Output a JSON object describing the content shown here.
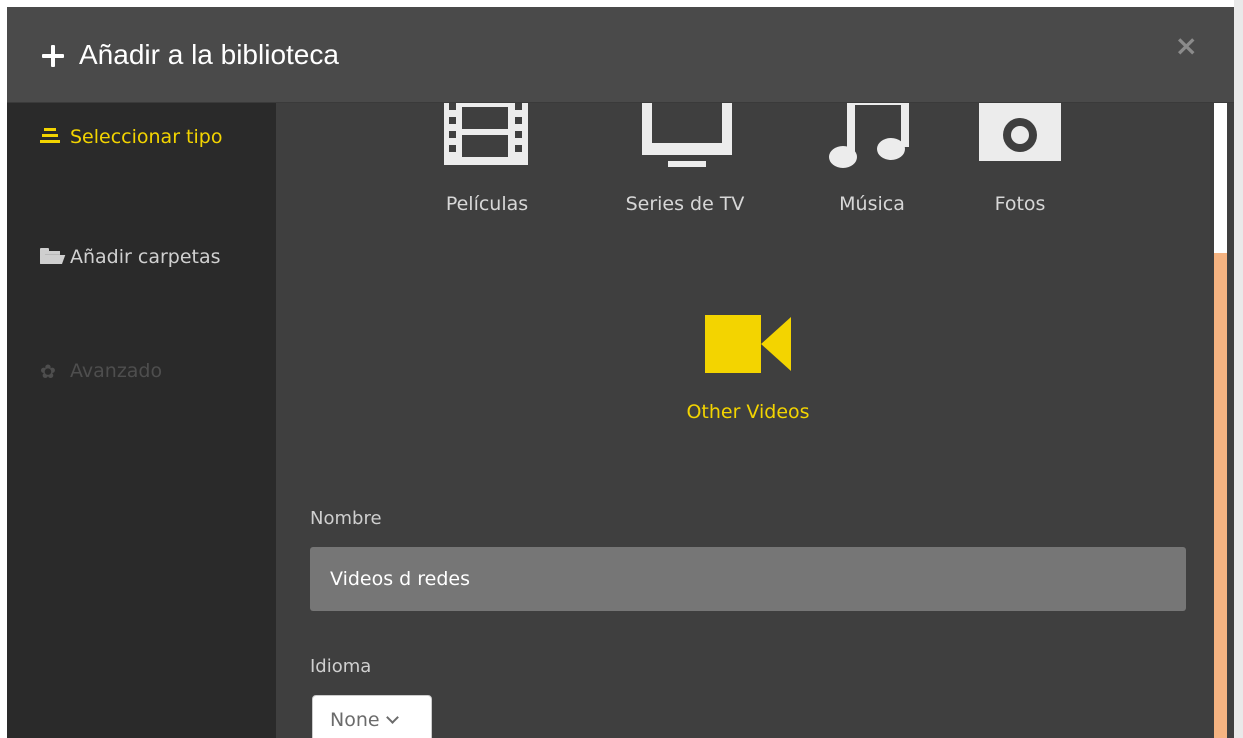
{
  "dialog": {
    "title": "Añadir a la biblioteca",
    "close_glyph": "×"
  },
  "sidebar": {
    "items": [
      {
        "label": "Seleccionar tipo",
        "icon": "list-icon",
        "state": "active",
        "color": "#f3d400"
      },
      {
        "label": "Añadir carpetas",
        "icon": "folder-open-icon",
        "state": "enabled"
      },
      {
        "label": "Avanzado",
        "icon": "gear-icon",
        "state": "disabled"
      }
    ]
  },
  "library_types": [
    {
      "label": "Películas",
      "icon": "film-icon",
      "selected": false
    },
    {
      "label": "Series de TV",
      "icon": "tv-icon",
      "selected": false
    },
    {
      "label": "Música",
      "icon": "music-note-icon",
      "selected": false
    },
    {
      "label": "Fotos",
      "icon": "camera-icon",
      "selected": false
    },
    {
      "label": "Other Videos",
      "icon": "video-camera-icon",
      "selected": true
    }
  ],
  "form": {
    "name_label": "Nombre",
    "name_value": "Videos d redes",
    "language_label": "Idioma",
    "language_value": "None"
  },
  "colors": {
    "accent": "#f3d400",
    "scrollbar_thumb": "#f5b381"
  }
}
